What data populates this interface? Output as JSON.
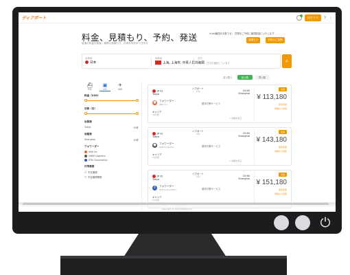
{
  "brand": {
    "logo": "ディアポート",
    "accent": "#f39800",
    "green": "#43b15a"
  },
  "header": {
    "login_label": "ログイン",
    "icons": [
      "bell-icon",
      "question-icon",
      "menu-icon"
    ]
  },
  "hero": {
    "title": "料金、見積もり、予約、発送",
    "subtitle": "航運の料金を検索、実際の見積もり、お得な予約ができます。",
    "note": "HubL輸送を手数でる！ 貨物をご予約に最適配送にいたします",
    "btn_primary": "見積もり",
    "btn_secondary": "予約のご質問"
  },
  "search": {
    "origin_label": "出発地",
    "origin_value": "日本",
    "dest_label": "到着地",
    "dest_value": "上海, 上海市, 中華人民共和国",
    "date_label": "日付",
    "date_value": "10/23 - 日付を選択しています",
    "search_icon": "search-icon"
  },
  "sort": {
    "label": "並び替え",
    "options": [
      "安い順",
      "早い順"
    ],
    "active_index": 0
  },
  "sidebar": {
    "modes": [
      {
        "label": "FCL",
        "icon": "ship-icon"
      },
      {
        "label": "LCL",
        "icon": "box-icon"
      },
      {
        "label": "AIR",
        "icon": "plane-icon"
      }
    ],
    "active_mode": 1,
    "filters": [
      {
        "title": "料金（USD）",
        "type": "slider"
      },
      {
        "title": "日数（日）",
        "type": "slider"
      },
      {
        "title": "出発港",
        "type": "list",
        "items": [
          {
            "name": "Tokyo",
            "count": "30件"
          }
        ]
      },
      {
        "title": "到着港",
        "type": "list",
        "items": [
          {
            "name": "Shanghai",
            "count": "30件"
          }
        ]
      },
      {
        "title": "フォワーダー",
        "type": "check",
        "items": [
          "ANJI Inc",
          "UNIM Logistics",
          "KTN Corporation"
        ]
      },
      {
        "title": "付帯業務",
        "type": "check",
        "items": [
          "不定期便",
          "不定期便業務"
        ]
      }
    ]
  },
  "results": [
    {
      "route_title": "ハブポート",
      "origin_code": "JP 02",
      "origin_city": "Tokyo",
      "mid_label": "LCL",
      "dest_code": "CN 60",
      "dest_city": "Shanghai",
      "carrier_label": "フォワーダー",
      "carrier_name": "ANJI Inc.",
      "service": "基本付帯サービス",
      "insurance_label": "キャリア",
      "insurance_value": "10日間",
      "details": "> 詳細を見る",
      "badge": "お得",
      "price": "¥ 113,180",
      "note1": "配達手配",
      "note2": "見積もり比較",
      "icon_color": "#d96b3a"
    },
    {
      "route_title": "ハブポート",
      "origin_code": "JP 02",
      "origin_city": "Tokyo",
      "mid_label": "LCL",
      "dest_code": "CN 60",
      "dest_city": "Shanghai",
      "carrier_label": "フォワーダー",
      "carrier_name": "UNIM Logistics",
      "service": "基本付帯サービス",
      "insurance_label": "キャリア",
      "insurance_value": "10日間",
      "details": "> 詳細を見る",
      "badge": "お得",
      "price": "¥ 143,180",
      "note1": "配達手配",
      "note2": "見積もり比較",
      "icon_color": "#555555"
    },
    {
      "route_title": "ハブポート",
      "origin_code": "JP 02",
      "origin_city": "Tokyo",
      "mid_label": "LCL",
      "dest_code": "CN 60",
      "dest_city": "Shanghai",
      "carrier_label": "フォワーダー",
      "carrier_name": "KTN Corporation",
      "service": "基本付帯サービス",
      "insurance_label": "キャリア",
      "insurance_value": "10日間",
      "details": "> 詳細を見る",
      "badge": "お得",
      "price": "¥ 151,180",
      "note1": "配達手配",
      "note2": "見積もり比較",
      "icon_color": "#2a5db0"
    }
  ],
  "footer": {
    "copyright": "Copyright © 2024 HubPort Inc."
  }
}
